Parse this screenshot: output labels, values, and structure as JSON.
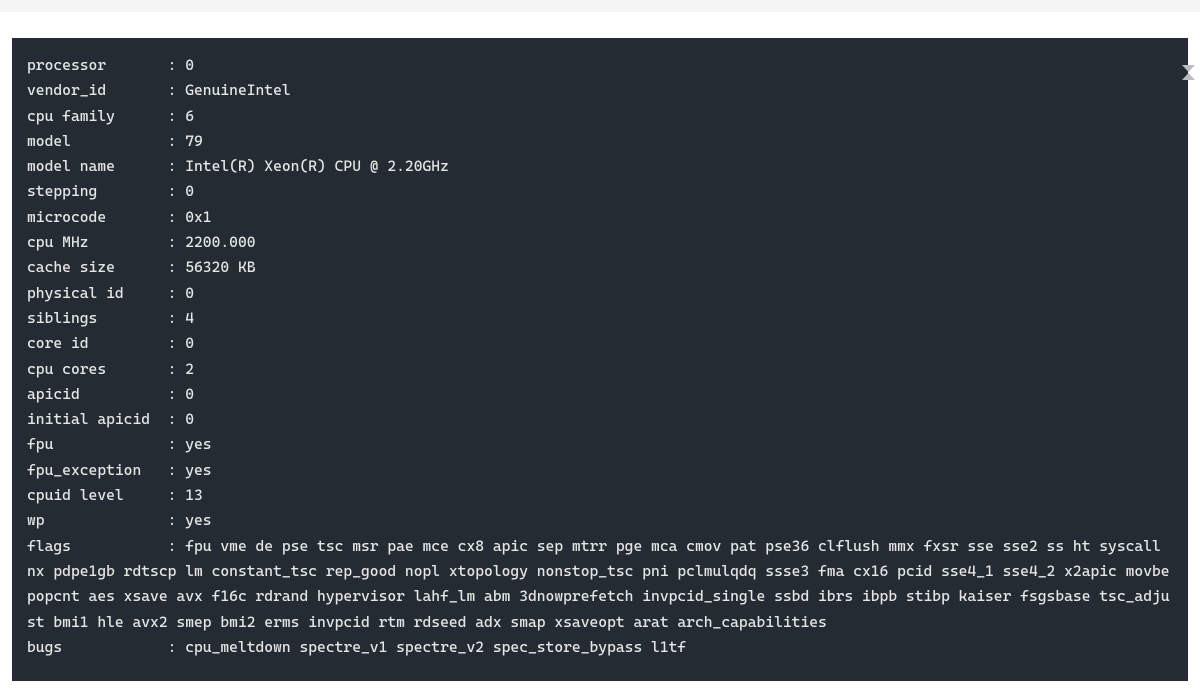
{
  "cpu_info": {
    "processor": {
      "key": "processor",
      "value": "0"
    },
    "vendor_id": {
      "key": "vendor_id",
      "value": "GenuineIntel"
    },
    "cpu_family": {
      "key": "cpu family",
      "value": "6"
    },
    "model": {
      "key": "model",
      "value": "79"
    },
    "model_name": {
      "key": "model name",
      "value": "Intel(R) Xeon(R) CPU @ 2.20GHz"
    },
    "stepping": {
      "key": "stepping",
      "value": "0"
    },
    "microcode": {
      "key": "microcode",
      "value": "0x1"
    },
    "cpu_mhz": {
      "key": "cpu MHz",
      "value": "2200.000"
    },
    "cache_size": {
      "key": "cache size",
      "value": "56320 KB"
    },
    "physical_id": {
      "key": "physical id",
      "value": "0"
    },
    "siblings": {
      "key": "siblings",
      "value": "4"
    },
    "core_id": {
      "key": "core id",
      "value": "0"
    },
    "cpu_cores": {
      "key": "cpu cores",
      "value": "2"
    },
    "apicid": {
      "key": "apicid",
      "value": "0"
    },
    "initial_apicid": {
      "key": "initial apicid",
      "value": "0"
    },
    "fpu": {
      "key": "fpu",
      "value": "yes"
    },
    "fpu_exception": {
      "key": "fpu_exception",
      "value": "yes"
    },
    "cpuid_level": {
      "key": "cpuid level",
      "value": "13"
    },
    "wp": {
      "key": "wp",
      "value": "yes"
    },
    "flags": {
      "key": "flags",
      "value": "fpu vme de pse tsc msr pae mce cx8 apic sep mtrr pge mca cmov pat pse36 clflush mmx fxsr sse sse2 ss ht syscall nx pdpe1gb rdtscp lm constant_tsc rep_good nopl xtopology nonstop_tsc pni pclmulqdq ssse3 fma cx16 pcid sse4_1 sse4_2 x2apic movbe popcnt aes xsave avx f16c rdrand hypervisor lahf_lm abm 3dnowprefetch invpcid_single ssbd ibrs ibpb stibp kaiser fsgsbase tsc_adjust bmi1 hle avx2 smep bmi2 erms invpcid rtm rdseed adx smap xsaveopt arat arch_capabilities"
    },
    "bugs": {
      "key": "bugs",
      "value": "cpu_meltdown spectre_v1 spectre_v2 spec_store_bypass l1tf"
    }
  },
  "key_width": 16
}
